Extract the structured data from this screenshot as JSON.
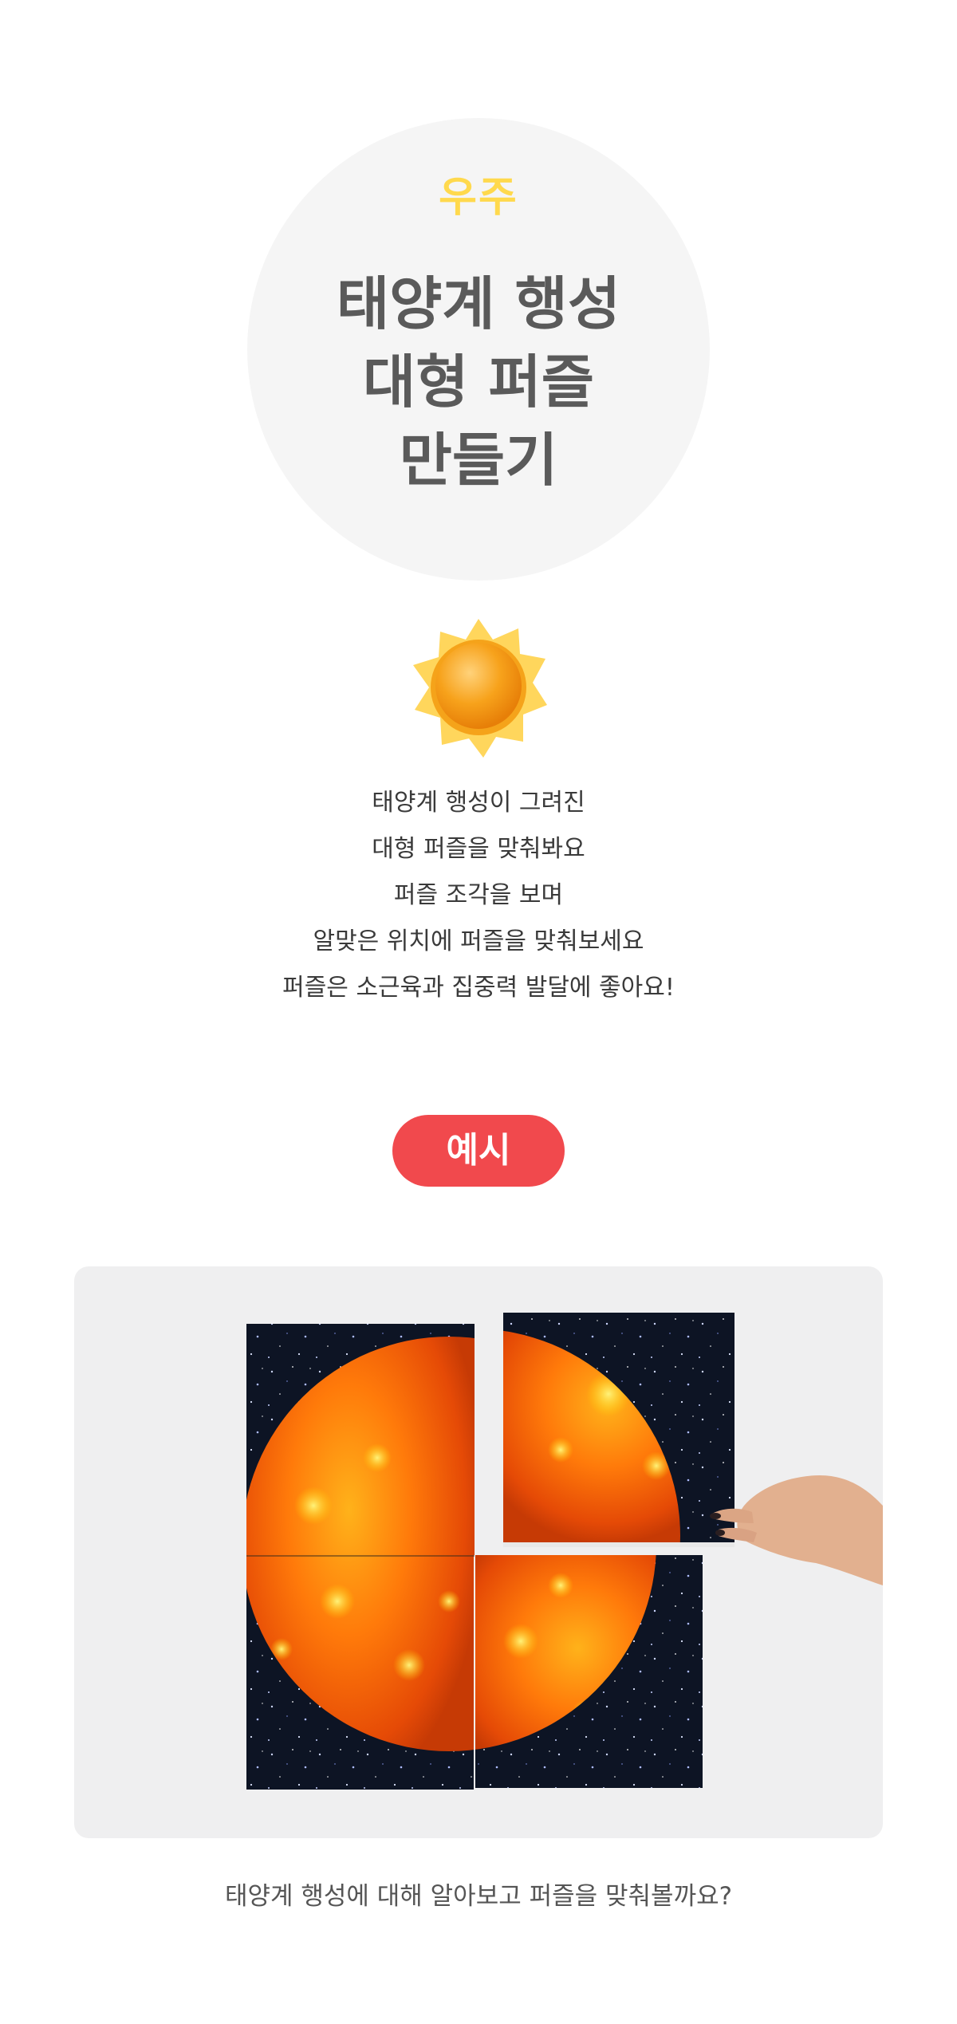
{
  "header": {
    "category": "우주",
    "title_lines": [
      "태양계 행성",
      "대형 퍼즐",
      "만들기"
    ]
  },
  "icon": "sun-icon",
  "description": {
    "lines": [
      "태양계 행성이 그려진",
      "대형 퍼즐을 맞춰봐요",
      "퍼즐 조각을 보며",
      "알맞은 위치에 퍼즐을 맞춰보세요",
      "퍼즐은 소근육과 집중력 발달에 좋아요!"
    ]
  },
  "example": {
    "badge_label": "예시",
    "photo": "sun-puzzle-photo",
    "caption": "태양계 행성에 대해 알아보고 퍼즐을 맞춰볼까요?"
  },
  "colors": {
    "category": "#ffd94d",
    "title": "#5a5a5a",
    "badge": "#f1494d",
    "circle_bg": "#f5f5f5",
    "card_bg": "#efeff0"
  }
}
